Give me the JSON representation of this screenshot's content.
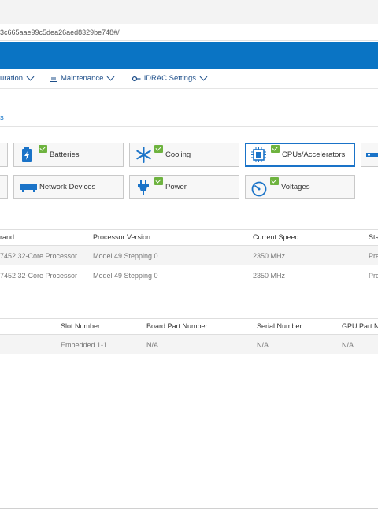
{
  "browser": {
    "url_fragment": "3c665aae99c5dea26aed8329be748#/"
  },
  "nav": {
    "configuration_label": "uration",
    "maintenance_label": "Maintenance",
    "idrac_settings_label": "iDRAC Settings"
  },
  "breadcrumb": {
    "text": "s"
  },
  "tiles": {
    "batteries": "Batteries",
    "cooling": "Cooling",
    "cpus": "CPUs/Accelerators",
    "network_devices": "Network Devices",
    "power": "Power",
    "voltages": "Voltages"
  },
  "processors": {
    "headers": {
      "brand": "rand",
      "version": "Processor Version",
      "speed": "Current Speed",
      "status": "Sta"
    },
    "rows": [
      {
        "brand": "7452 32-Core Processor",
        "version": "Model 49 Stepping 0",
        "speed": "2350 MHz",
        "status": "Pre"
      },
      {
        "brand": "7452 32-Core Processor",
        "version": "Model 49 Stepping 0",
        "speed": "2350 MHz",
        "status": "Pre"
      }
    ]
  },
  "accelerators": {
    "headers": {
      "slot": "Slot Number",
      "board_part": "Board Part Number",
      "serial": "Serial Number",
      "gpu_part": "GPU Part N"
    },
    "rows": [
      {
        "slot": "Embedded 1-1",
        "board_part": "N/A",
        "serial": "N/A",
        "gpu_part": "N/A"
      }
    ]
  },
  "colors": {
    "brand_blue": "#0a74c4",
    "status_green": "#6eb33f",
    "link_blue": "#0b6fc7"
  }
}
